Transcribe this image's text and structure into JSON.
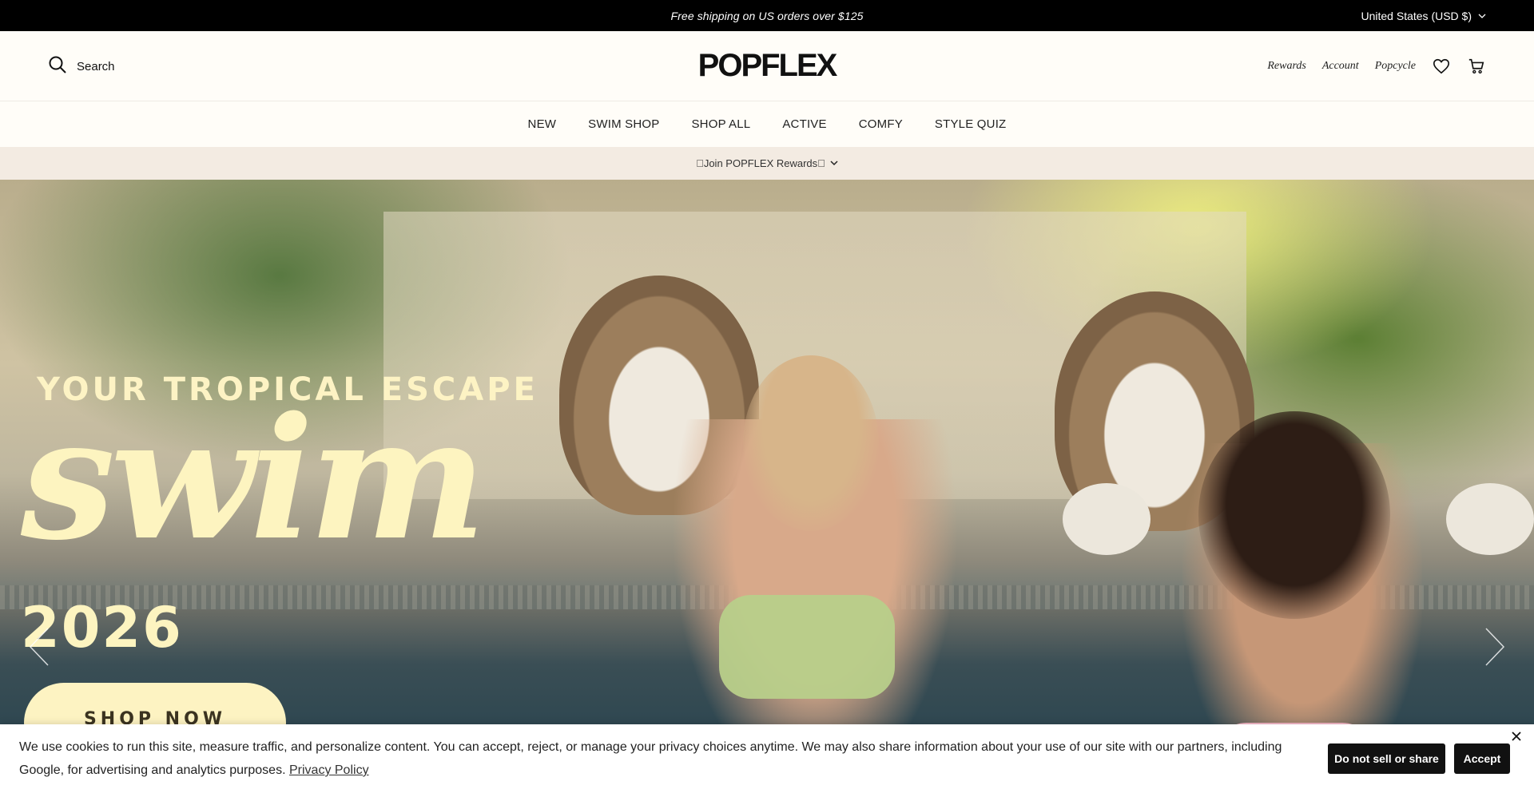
{
  "announcement": {
    "message": "Free shipping on US orders over $125",
    "currency": "United States (USD $)"
  },
  "header": {
    "search_label": "Search",
    "logo_text": "POPFLEX",
    "links": {
      "rewards": "Rewards",
      "account": "Account",
      "popcycle": "Popcycle"
    },
    "icons": {
      "search": "search-icon",
      "wishlist": "heart-icon",
      "cart": "cart-icon"
    }
  },
  "nav": {
    "items": [
      "NEW",
      "SWIM SHOP",
      "SHOP ALL",
      "ACTIVE",
      "COMFY",
      "STYLE QUIZ"
    ]
  },
  "rewards_strip": {
    "label": "􀀀Join POPFLEX Rewards􀀀"
  },
  "hero": {
    "tagline": "YOUR TROPICAL ESCAPE",
    "script_word": "swim",
    "year": "2026",
    "cta": "SHOP NOW"
  },
  "cookie_banner": {
    "text": "We use cookies to run this site, measure traffic, and personalize content. You can accept, reject, or manage your privacy choices anytime. We may also share information about your use of our site with our partners, including Google, for advertising and analytics purposes.",
    "privacy_link": "Privacy Policy",
    "do_not_sell": "Do not sell or share",
    "accept": "Accept"
  },
  "colors": {
    "announcement_bg": "#000000",
    "header_bg": "#fffdf8",
    "rewards_bg": "#f3ebe2",
    "hero_text": "#fdf4c0",
    "button_dark": "#111111"
  }
}
